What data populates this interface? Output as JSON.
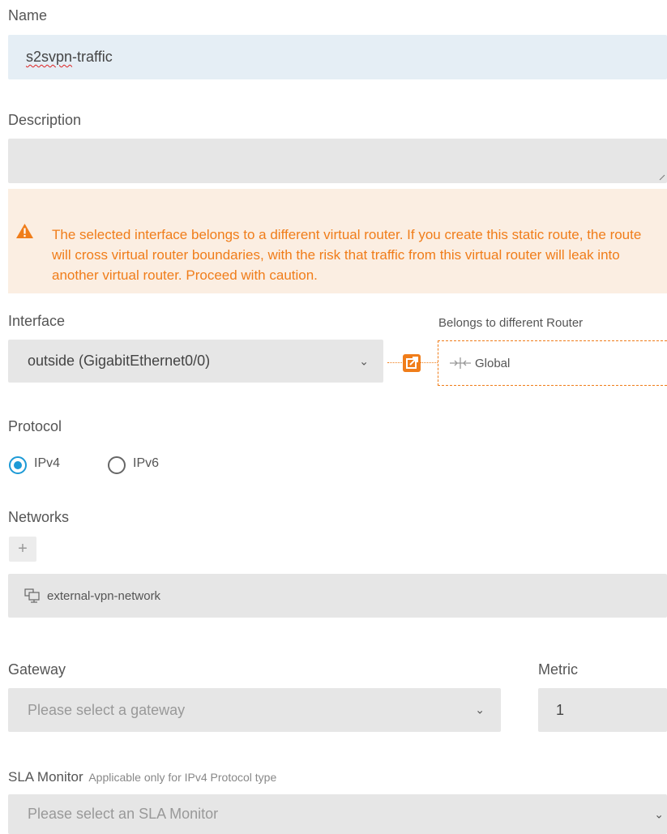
{
  "name": {
    "label": "Name",
    "value_misspelled": "s2svpn",
    "value_rest": "-traffic"
  },
  "description": {
    "label": "Description",
    "value": ""
  },
  "warning": {
    "text": "The selected interface belongs to a different virtual router. If you create this static route, the route will cross virtual router boundaries, with the risk that traffic from this virtual router will leak into another virtual router. Proceed with caution.",
    "color": "#f07d1a"
  },
  "interface": {
    "label": "Interface",
    "selected": "outside (GigabitEthernet0/0)",
    "router_note": "Belongs to different Router",
    "router_name": "Global"
  },
  "protocol": {
    "label": "Protocol",
    "options": [
      {
        "label": "IPv4",
        "checked": true
      },
      {
        "label": "IPv6",
        "checked": false
      }
    ]
  },
  "networks": {
    "label": "Networks",
    "add_symbol": "+",
    "items": [
      "external-vpn-network"
    ]
  },
  "gateway": {
    "label": "Gateway",
    "placeholder": "Please select a gateway"
  },
  "metric": {
    "label": "Metric",
    "value": "1"
  },
  "sla": {
    "label": "SLA Monitor",
    "hint": "Applicable only for IPv4 Protocol type",
    "placeholder": "Please select an SLA Monitor"
  },
  "icons": {
    "warning": "warning-triangle-icon",
    "link": "external-link-icon",
    "router": "move-arrows-icon",
    "network": "network-object-icon",
    "dropdown": "chevron-down-icon"
  },
  "colors": {
    "accent": "#1d9ad6",
    "warning": "#f07d1a"
  }
}
